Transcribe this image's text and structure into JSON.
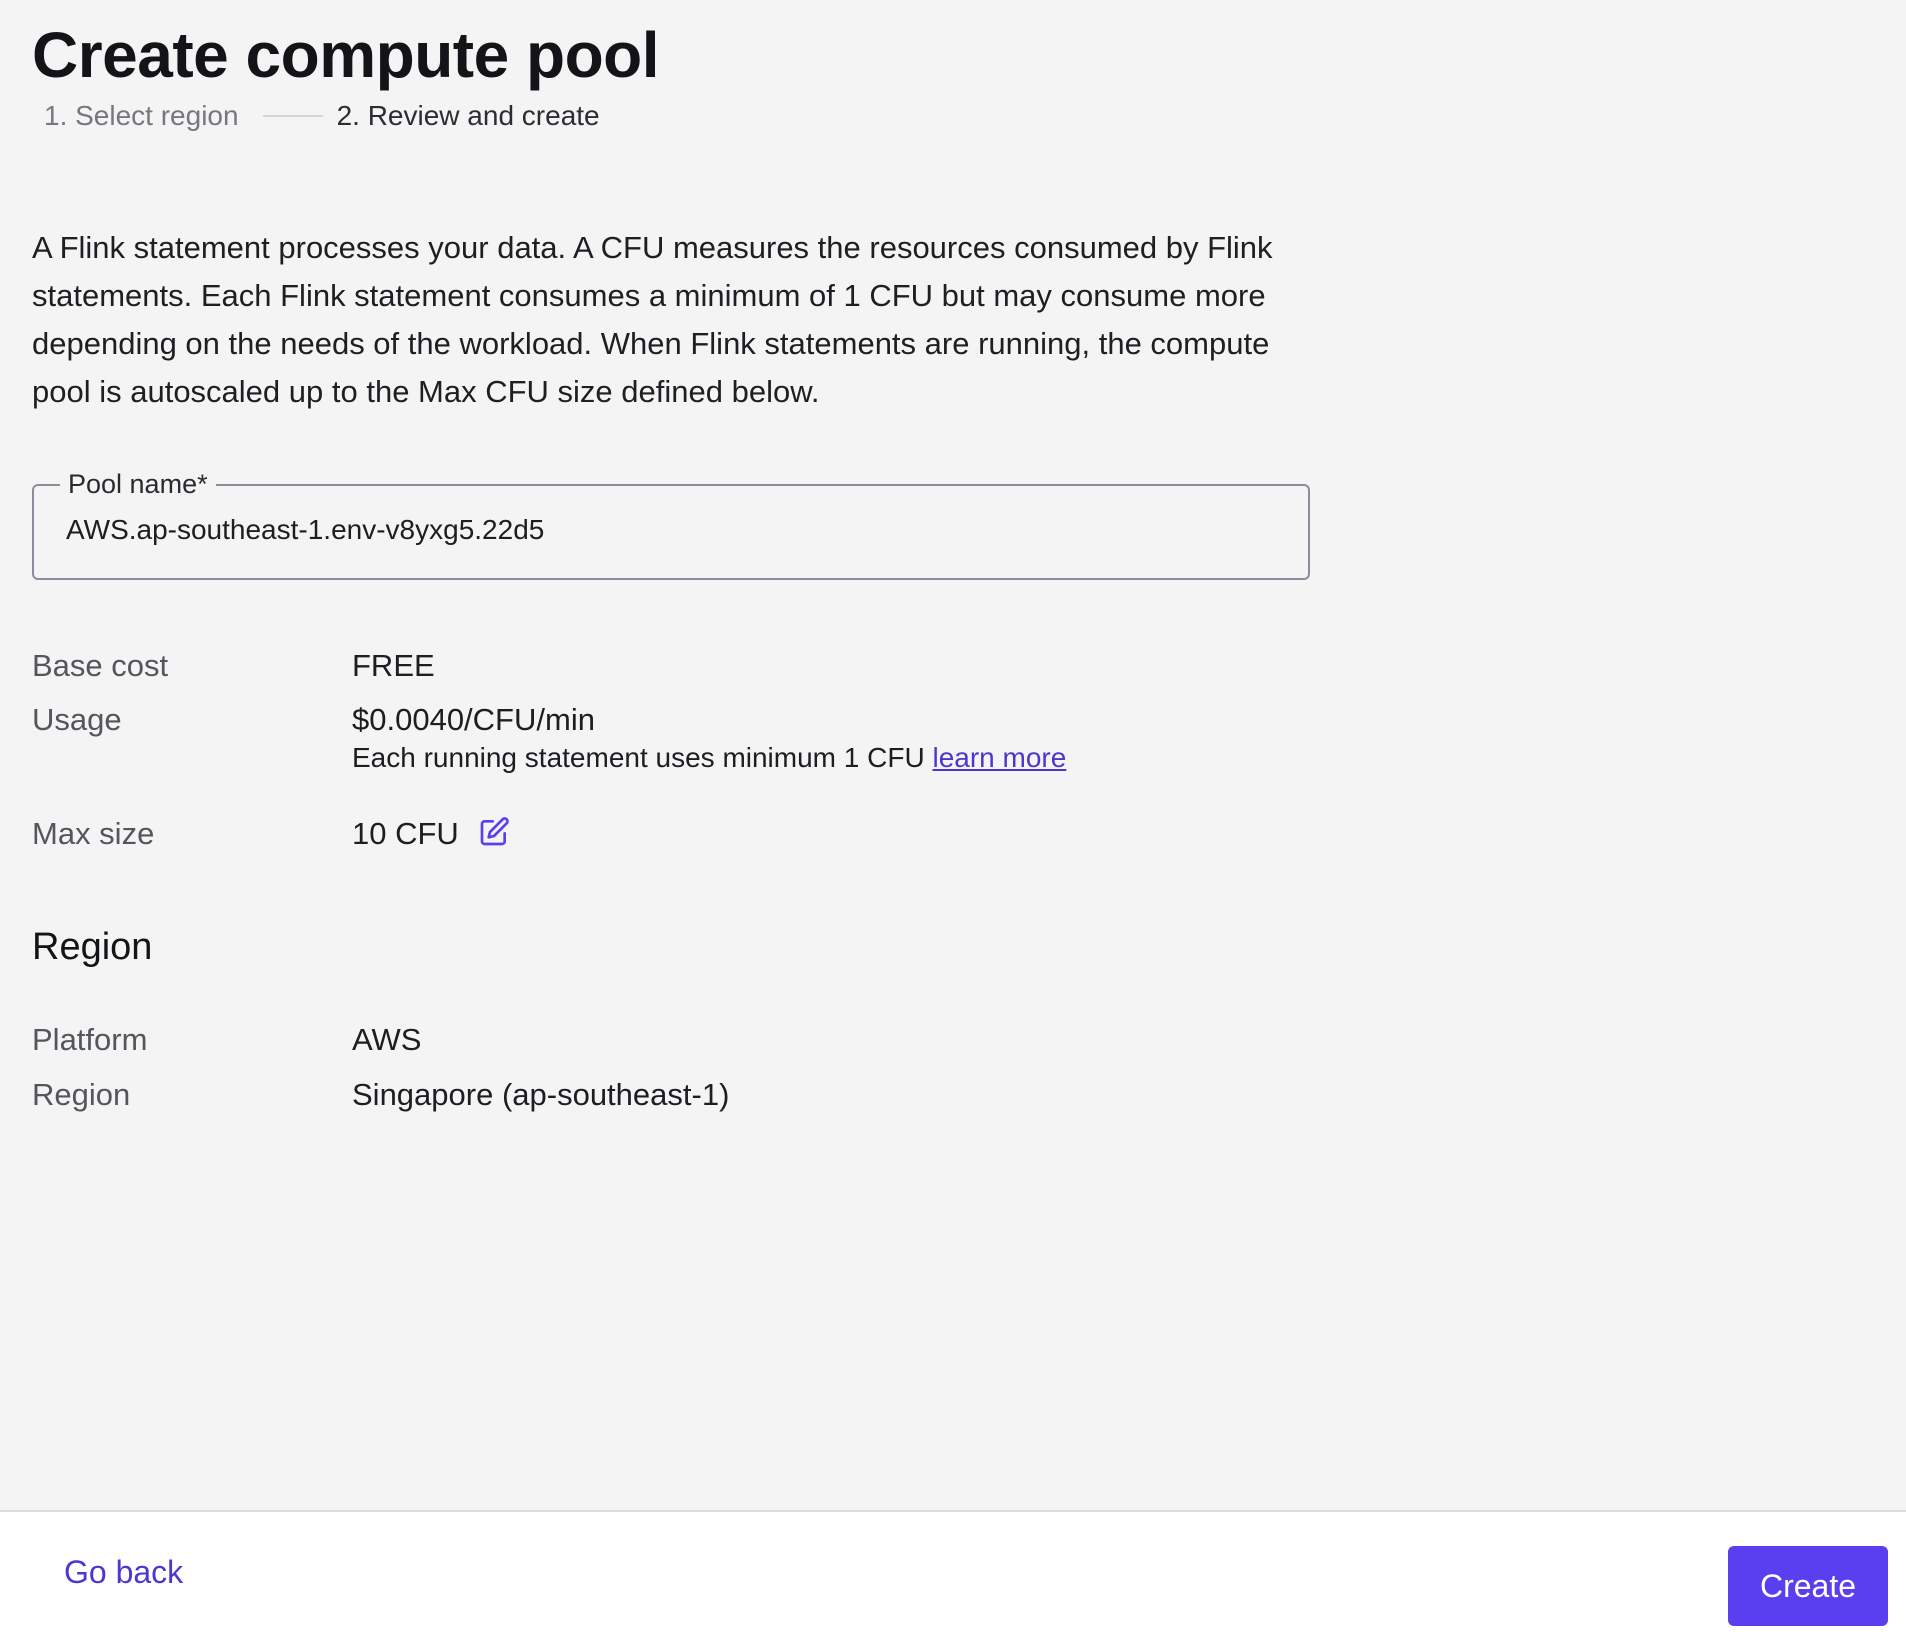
{
  "header": {
    "title": "Create compute pool",
    "steps": [
      {
        "label": "1. Select region",
        "state": "completed"
      },
      {
        "label": "2. Review and create",
        "state": "current"
      }
    ]
  },
  "description": "A Flink statement processes your data. A CFU measures the resources consumed by Flink statements. Each Flink statement consumes a minimum of 1 CFU but may consume more depending on the needs of the workload. When Flink statements are running, the compute pool is autoscaled up to the Max CFU size defined below.",
  "pool_name": {
    "label": "Pool name*",
    "value": "AWS.ap-southeast-1.env-v8yxg5.22d5"
  },
  "pricing": {
    "base_cost": {
      "label": "Base cost",
      "value": "FREE"
    },
    "usage": {
      "label": "Usage",
      "value": "$0.0040/CFU/min",
      "note": "Each running statement uses minimum 1 CFU",
      "link": "learn more"
    },
    "max_size": {
      "label": "Max size",
      "value": "10 CFU",
      "icon": "edit-icon"
    }
  },
  "region_section": {
    "heading": "Region",
    "platform": {
      "label": "Platform",
      "value": "AWS"
    },
    "region": {
      "label": "Region",
      "value": "Singapore (ap-southeast-1)"
    }
  },
  "footer": {
    "back_label": "Go back",
    "create_label": "Create"
  },
  "colors": {
    "accent": "#5a3ff0",
    "link": "#4b37d1",
    "background": "#f4f4f4"
  }
}
